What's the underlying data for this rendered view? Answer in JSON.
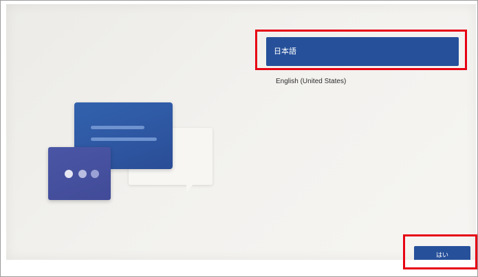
{
  "language_list": {
    "selected": "日本語",
    "other": "English (United States)"
  },
  "buttons": {
    "confirm_label": "はい"
  },
  "colors": {
    "accent": "#26509a",
    "highlight": "#e60012",
    "card_blue": "#2e56a1",
    "card_purple": "#4350a0",
    "card_white": "#f7f6f3"
  },
  "illustration": {
    "icon": "language-chat-illustration"
  }
}
